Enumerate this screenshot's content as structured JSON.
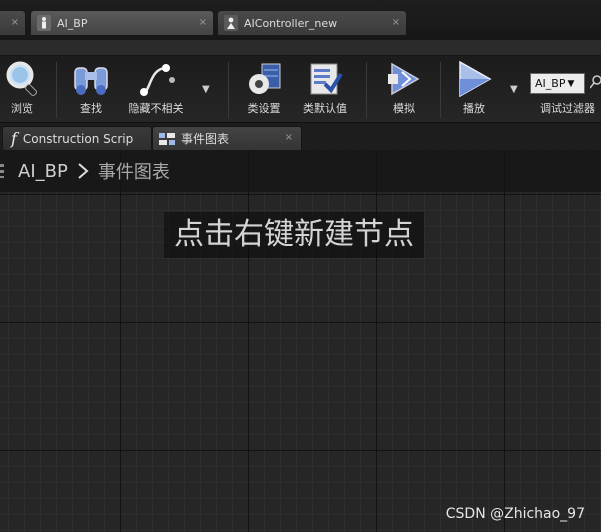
{
  "doc_tabs": [
    {
      "label": "AI_BP",
      "close": "×",
      "icon": "character-icon"
    },
    {
      "label": "AIController_new",
      "close": "×",
      "icon": "controller-icon"
    }
  ],
  "prev_tab_close": "×",
  "toolbar": {
    "browse": "浏览",
    "find": "查找",
    "hide_unrelated": "隐藏不相关",
    "class_settings": "类设置",
    "class_defaults": "类默认值",
    "simulate": "模拟",
    "play": "播放",
    "debug_object": "AI_BP",
    "debug_filter": "调试过滤器"
  },
  "graph_tabs": [
    {
      "label": "Construction Scrip",
      "icon_glyph": "f",
      "close": ""
    },
    {
      "label": "事件图表",
      "close": "×"
    }
  ],
  "breadcrumb": {
    "root": "AI_BP",
    "current": "事件图表"
  },
  "graph": {
    "hint": "点击右键新建节点"
  },
  "watermark": "CSDN @Zhichao_97",
  "colors": {
    "accent_blue": "#4a7bd8",
    "toolbar_bg": "#262626",
    "graph_bg": "#262626"
  }
}
